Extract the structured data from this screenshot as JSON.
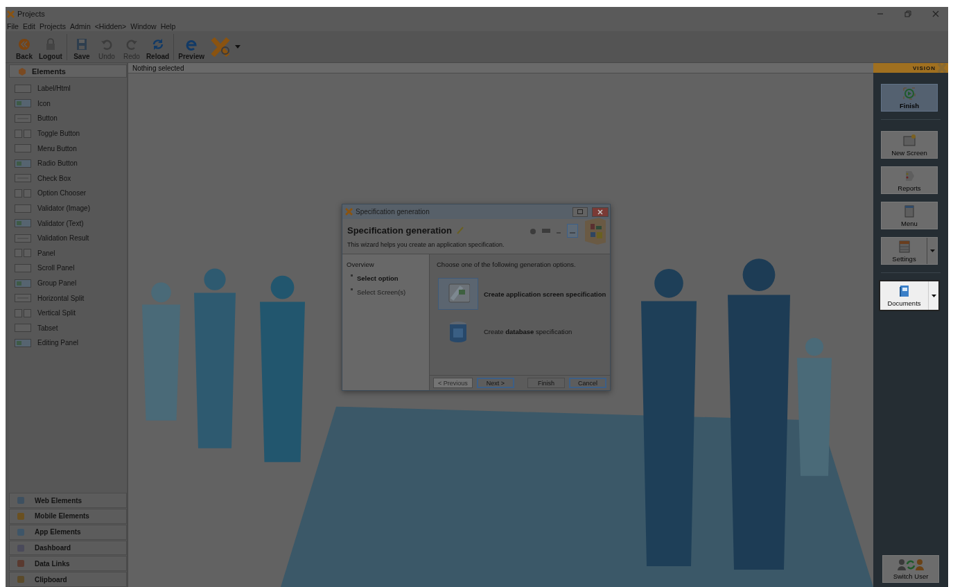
{
  "window": {
    "title": "Projects"
  },
  "menu": [
    "File",
    "Edit",
    "Projects",
    "Admin",
    "<Hidden>",
    "Window",
    "Help"
  ],
  "toolbar": {
    "groups": [
      [
        {
          "label": "Back",
          "disabled": false
        },
        {
          "label": "Logout",
          "disabled": false
        }
      ],
      [
        {
          "label": "Save",
          "disabled": false
        },
        {
          "label": "Undo",
          "disabled": true
        },
        {
          "label": "Redo",
          "disabled": true
        },
        {
          "label": "Reload",
          "disabled": false
        }
      ],
      [
        {
          "label": "Preview",
          "disabled": false
        }
      ]
    ]
  },
  "elements_panel": {
    "title": "Elements",
    "items": [
      "Label/Html",
      "Icon",
      "Button",
      "Toggle Button",
      "Menu Button",
      "Radio Button",
      "Check Box",
      "Option Chooser",
      "Validator (Image)",
      "Validator (Text)",
      "Validation Result",
      "Panel",
      "Scroll Panel",
      "Group Panel",
      "Horizontal Split",
      "Vertical Split",
      "Tabset",
      "Editing Panel"
    ],
    "categories": [
      "Web Elements",
      "Mobile Elements",
      "App Elements",
      "Dashboard",
      "Data Links",
      "Clipboard"
    ]
  },
  "status": "Nothing selected",
  "right_panel": {
    "brand": "VISION",
    "groups": [
      [
        {
          "label": "Finish",
          "active": true,
          "spotlight": false,
          "has_menu": false
        }
      ],
      [
        {
          "label": "New Screen",
          "active": false,
          "spotlight": false,
          "has_menu": false
        },
        {
          "label": "Reports",
          "active": false,
          "spotlight": false,
          "has_menu": false
        },
        {
          "label": "Menu",
          "active": false,
          "spotlight": false,
          "has_menu": false
        },
        {
          "label": "Settings",
          "active": false,
          "spotlight": false,
          "has_menu": true
        }
      ],
      [
        {
          "label": "Documents",
          "active": false,
          "spotlight": true,
          "has_menu": true
        }
      ]
    ],
    "footer": {
      "label": "Switch User"
    }
  },
  "dialog": {
    "title": "Specification generation",
    "heading": "Specification generation",
    "subtitle": "This wizard helps you create an application specification.",
    "overview": "Overview",
    "steps": [
      {
        "label": "Select option",
        "current": true
      },
      {
        "label": "Select Screen(s)",
        "current": false
      }
    ],
    "prompt": "Choose one of the following generation options.",
    "options": [
      {
        "label": "Create application screen specification",
        "selected": true
      },
      {
        "label": "Create **database** specification",
        "selected": false
      }
    ],
    "buttons": [
      {
        "label": "< Previous",
        "disabled": true,
        "focused": false
      },
      {
        "label": "Next >",
        "disabled": false,
        "focused": true
      },
      {
        "label": "Finish",
        "disabled": false,
        "focused": false
      },
      {
        "label": "Cancel",
        "disabled": false,
        "focused": true
      }
    ]
  }
}
